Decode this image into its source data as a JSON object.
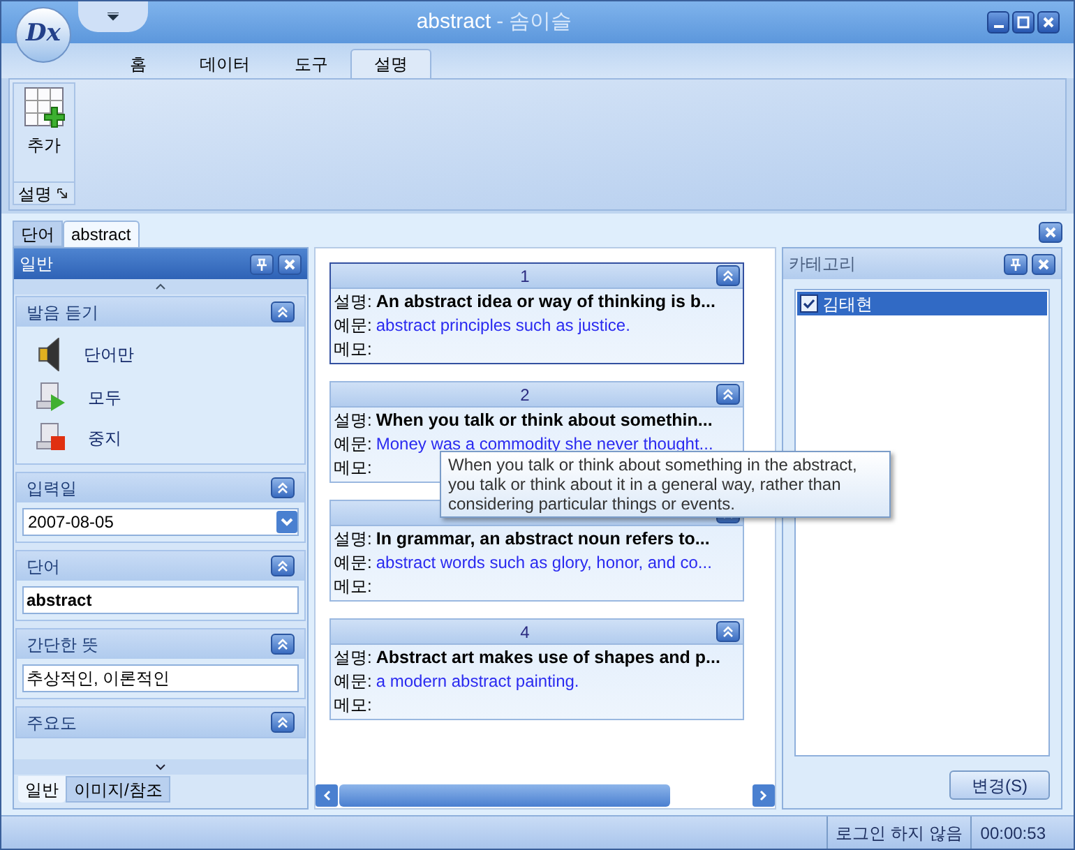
{
  "window": {
    "logo_text": "Dx",
    "title": "abstract",
    "separator": "-",
    "app_name": "솜이슬"
  },
  "ribbon": {
    "tabs": [
      {
        "label": "홈",
        "selected": false
      },
      {
        "label": "데이터",
        "selected": false
      },
      {
        "label": "도구",
        "selected": false
      },
      {
        "label": "설명",
        "selected": true
      }
    ],
    "group": {
      "label": "설명",
      "button": "추가"
    }
  },
  "doc_tabs": [
    {
      "label": "단어",
      "selected": false
    },
    {
      "label": "abstract",
      "selected": true
    }
  ],
  "left_panel": {
    "title": "일반",
    "sections": [
      {
        "title": "발음 듣기",
        "kind": "actions",
        "items": [
          {
            "label": "단어만",
            "kind": "speaker"
          },
          {
            "label": "모두",
            "kind": "play"
          },
          {
            "label": "중지",
            "kind": "stop"
          }
        ]
      },
      {
        "title": "입력일",
        "kind": "date",
        "value": "2007-08-05"
      },
      {
        "title": "단어",
        "kind": "word",
        "value": "abstract"
      },
      {
        "title": "간단한 뜻",
        "kind": "text",
        "value": "추상적인, 이론적인"
      },
      {
        "title": "주요도",
        "kind": "header"
      }
    ],
    "bottom_tabs": [
      {
        "label": "일반",
        "selected": true
      },
      {
        "label": "이미지/참조",
        "selected": false
      }
    ]
  },
  "cards": [
    {
      "number": "1",
      "fields": [
        {
          "label": "설명:",
          "value": "An abstract idea or way of thinking is b...",
          "kind": "description"
        },
        {
          "label": "예문:",
          "value": "abstract principles such as justice.",
          "kind": "example"
        },
        {
          "label": "메모:",
          "kind": "memo"
        }
      ]
    },
    {
      "number": "2",
      "fields": [
        {
          "label": "설명:",
          "value": "When you talk or think about somethin...",
          "kind": "description"
        },
        {
          "label": "예문:",
          "value": "Money was a commodity she never thought...",
          "kind": "example"
        },
        {
          "label": "메모:",
          "kind": "memo"
        }
      ]
    },
    {
      "fields": [
        {
          "label": "설명:",
          "value": "In grammar, an abstract noun refers to...",
          "kind": "description"
        },
        {
          "label": "예문:",
          "value": "abstract words such as glory, honor, and co...",
          "kind": "example"
        },
        {
          "label": "메모:",
          "kind": "memo"
        }
      ]
    },
    {
      "number": "4",
      "fields": [
        {
          "label": "설명:",
          "value": "Abstract art makes use of shapes and p...",
          "kind": "description"
        },
        {
          "label": "예문:",
          "value": "a modern abstract painting.",
          "kind": "example"
        },
        {
          "label": "메모:",
          "kind": "memo"
        }
      ]
    }
  ],
  "tooltip": "When you talk or think about something in the abstract, you talk or think about it in a general way, rather than considering particular things or events.",
  "category_panel": {
    "title": "카테고리",
    "items": [
      {
        "label": "김태현",
        "checked": true,
        "selected": true
      }
    ],
    "button": "변경(S)"
  },
  "status_bar": {
    "login": "로그인 하지 않음",
    "time": "00:00:53"
  }
}
